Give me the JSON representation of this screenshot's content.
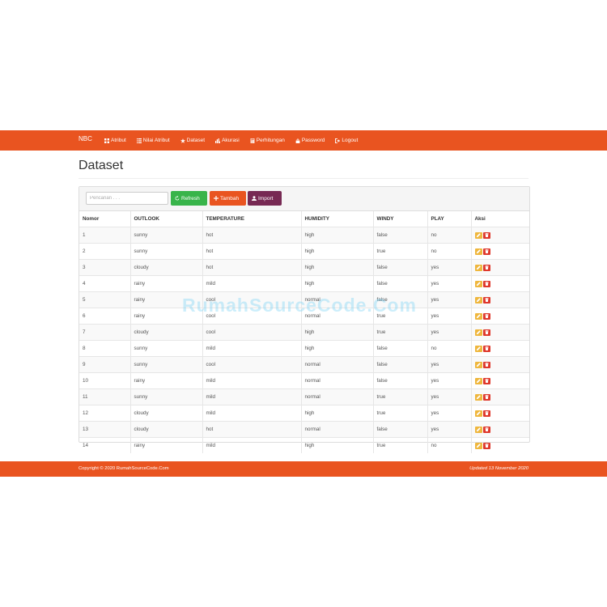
{
  "navbar": {
    "brand": "NBC",
    "items": [
      {
        "label": "Atribut",
        "icon": "grid-icon"
      },
      {
        "label": "Nilai Atribut",
        "icon": "list-icon"
      },
      {
        "label": "Dataset",
        "icon": "star-icon"
      },
      {
        "label": "Akurasi",
        "icon": "bar-chart-icon"
      },
      {
        "label": "Perhitungan",
        "icon": "calculator-icon"
      },
      {
        "label": "Password",
        "icon": "lock-icon"
      },
      {
        "label": "Logout",
        "icon": "logout-icon"
      }
    ]
  },
  "page": {
    "title": "Dataset"
  },
  "toolbar": {
    "search_placeholder": "Pencarian . . .",
    "refresh_label": "Refresh",
    "tambah_label": "Tambah",
    "import_label": "Import"
  },
  "table": {
    "headers": [
      "Nomor",
      "OUTLOOK",
      "TEMPERATURE",
      "HUMIDITY",
      "WINDY",
      "PLAY",
      "Aksi"
    ],
    "rows": [
      [
        "1",
        "sunny",
        "hot",
        "high",
        "false",
        "no"
      ],
      [
        "2",
        "sunny",
        "hot",
        "high",
        "true",
        "no"
      ],
      [
        "3",
        "cloudy",
        "hot",
        "high",
        "false",
        "yes"
      ],
      [
        "4",
        "rainy",
        "mild",
        "high",
        "false",
        "yes"
      ],
      [
        "5",
        "rainy",
        "cool",
        "normal",
        "false",
        "yes"
      ],
      [
        "6",
        "rainy",
        "cool",
        "normal",
        "true",
        "yes"
      ],
      [
        "7",
        "cloudy",
        "cool",
        "high",
        "true",
        "yes"
      ],
      [
        "8",
        "sunny",
        "mild",
        "high",
        "false",
        "no"
      ],
      [
        "9",
        "sunny",
        "cool",
        "normal",
        "false",
        "yes"
      ],
      [
        "10",
        "rainy",
        "mild",
        "normal",
        "false",
        "yes"
      ],
      [
        "11",
        "sunny",
        "mild",
        "normal",
        "true",
        "yes"
      ],
      [
        "12",
        "cloudy",
        "mild",
        "high",
        "true",
        "yes"
      ],
      [
        "13",
        "cloudy",
        "hot",
        "normal",
        "false",
        "yes"
      ],
      [
        "14",
        "rainy",
        "mild",
        "high",
        "true",
        "no"
      ]
    ]
  },
  "watermark": "RumahSourceCode.Com",
  "footer": {
    "copyright": "Copyright © 2020 RumahSourceCode.Com",
    "updated": "Updated 13 November 2020"
  },
  "colors": {
    "primary": "#e95420",
    "success": "#38b44a",
    "purple": "#772953",
    "warning": "#efb73e",
    "danger": "#df382c"
  }
}
